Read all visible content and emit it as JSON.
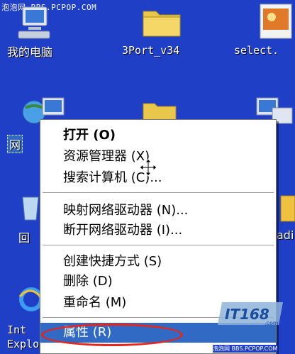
{
  "watermark_top": "泡泡网 BBS.PCPOP.COM",
  "desktop": {
    "icons": [
      {
        "label": "我的电脑"
      },
      {
        "label": "3Port_v34"
      },
      {
        "label": "select."
      },
      {
        "label": "网"
      },
      {
        "label": "回"
      },
      {
        "label": "Int"
      },
      {
        "label": "Explo"
      },
      {
        "label": "adi"
      }
    ]
  },
  "context_menu": {
    "items": [
      {
        "label": "打开 (O)",
        "bold": true
      },
      {
        "label": "资源管理器 (X)"
      },
      {
        "label": "搜索计算机 (C)..."
      },
      {
        "label": "映射网络驱动器 (N)..."
      },
      {
        "label": "断开网络驱动器 (I)..."
      },
      {
        "label": "创建快捷方式 (S)"
      },
      {
        "label": "删除 (D)"
      },
      {
        "label": "重命名 (M)"
      },
      {
        "label": "属性 (R)",
        "selected": true
      }
    ]
  },
  "logo_text": "IT168.com",
  "watermark_bottom": "泡泡网 BBS.PCPOP.COM",
  "colors": {
    "desktop": "#1f3fc6",
    "menu_bg": "#ffffff",
    "highlight": "#316ac5",
    "annotation": "#e3271d"
  }
}
